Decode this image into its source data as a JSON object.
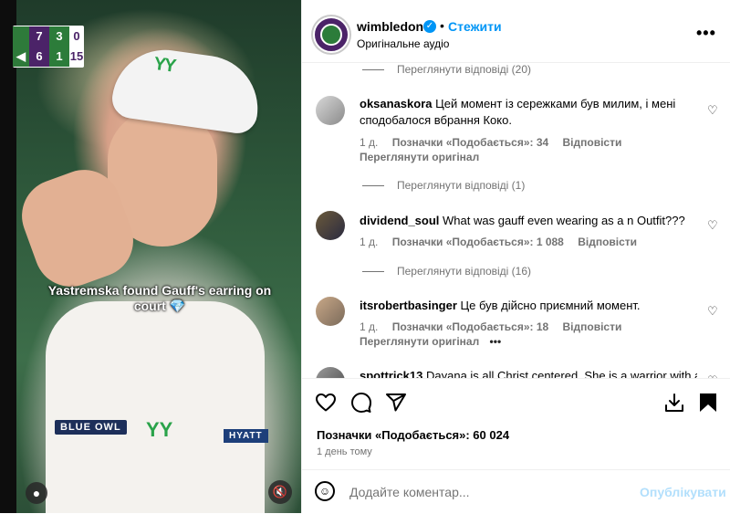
{
  "video": {
    "scoreboard": {
      "rows": [
        {
          "indicator": "",
          "set1": "7",
          "set2": "3",
          "points": "0"
        },
        {
          "indicator": "◀",
          "set1": "6",
          "set2": "1",
          "points": "15"
        }
      ]
    },
    "caption": "Yastremska found Gauff's earring on court 💎",
    "sponsors": [
      "BLUE OWL",
      "HYATT"
    ],
    "icons": {
      "user": "person-icon",
      "mute": "speaker-muted-icon"
    }
  },
  "header": {
    "username": "wimbledon",
    "verified_glyph": "✓",
    "separator": "•",
    "follow_label": "Стежити",
    "audio_label": "Оригінальне аудіо",
    "more_glyph": "•••"
  },
  "comments": {
    "replies_top": "Переглянути відповіді (20)",
    "items": [
      {
        "username": "oksanaskora",
        "text": "Цей момент із сережками був милим, і мені сподобалося вбрання Коко.",
        "time": "1 д.",
        "likes": "Позначки «Подобається»: 34",
        "reply": "Відповісти",
        "see_original": "Переглянути оригінал",
        "replies": "Переглянути відповіді (1)"
      },
      {
        "username": "dividend_soul",
        "text": "What was gauff even wearing as a n Outfit???",
        "time": "1 д.",
        "likes": "Позначки «Подобається»: 1 088",
        "reply": "Відповісти",
        "replies": "Переглянути відповіді (16)"
      },
      {
        "username": "itsrobertbasinger",
        "text": "Це був дійсно приємний момент.",
        "time": "1 д.",
        "likes": "Позначки «Подобається»: 18",
        "reply": "Відповісти",
        "see_original": "Переглянути оригінал",
        "more": "•••"
      },
      {
        "username": "spottrick13",
        "text": "Dayana is all Christ centered. She is a warrior with a"
      }
    ]
  },
  "actions": {
    "likes": "Позначки «Подобається»: 60 024",
    "time": "1 день тому"
  },
  "composer": {
    "placeholder": "Додайте коментар...",
    "post_label": "Опублікувати"
  }
}
